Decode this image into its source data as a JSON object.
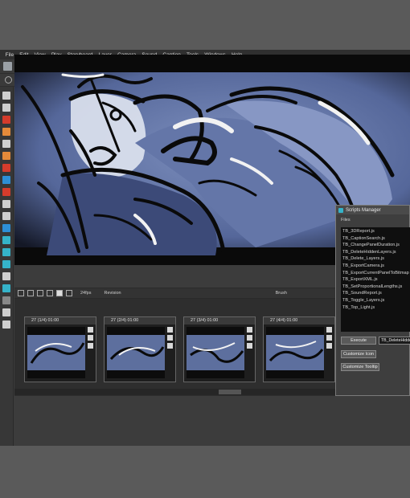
{
  "menubar": {
    "items": [
      "File",
      "Edit",
      "View",
      "Play",
      "Storyboard",
      "Layer",
      "Camera",
      "Sound",
      "Caption",
      "Tools",
      "Windows",
      "Help"
    ]
  },
  "timeline": {
    "fps": "24fps",
    "revision": "Revision",
    "brush": "Brush"
  },
  "panels": [
    {
      "label": "27 (1/4) 01:00"
    },
    {
      "label": "27 (2/4) 01:00"
    },
    {
      "label": "27 (3/4) 01:00"
    },
    {
      "label": "27 (4/4) 01:00"
    }
  ],
  "scripts_manager": {
    "title": "Scripts Manager",
    "files_label": "Files",
    "files": [
      "TB_3DReport.js",
      "TB_CaptionSearch.js",
      "TB_ChangePanelDuration.js",
      "TB_DeleteHiddenLayers.js",
      "TB_Delete_Layers.js",
      "TB_ExportCamera.js",
      "TB_ExportCurrentPanelToBitmap",
      "TB_ExportXML.js",
      "TB_SetProportionalLengths.js",
      "TB_SoundReport.js",
      "TB_Toggle_Layers.js",
      "TB_Top_Light.js"
    ],
    "execute_label": "Execute",
    "field_value": "TB_DeleteHidde",
    "customize_icon_label": "Customize Icon",
    "customize_tooltip_label": "Customize Tooltip"
  },
  "colors": {
    "stage_blue": "#5d6f9e",
    "highlight": "#f2f2f2",
    "ink": "#0a0a0a"
  }
}
